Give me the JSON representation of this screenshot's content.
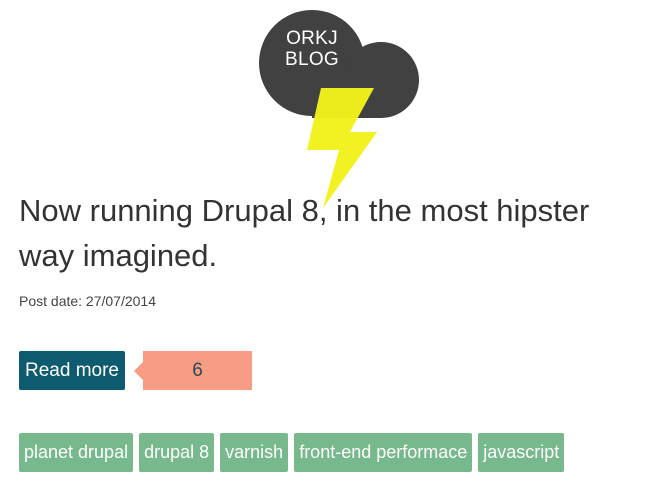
{
  "site": {
    "logo_line1": "ORKJ",
    "logo_line2": "BLOG",
    "cloud_color": "#414141",
    "bolt_color": "#f2f21c"
  },
  "article": {
    "title": "Now running Drupal 8, in the most hipster way imagined.",
    "post_date": "Post date: 27/07/2014",
    "read_more_label": "Read more",
    "comment_count": "6"
  },
  "tags": [
    {
      "label": "planet drupal"
    },
    {
      "label": "drupal 8"
    },
    {
      "label": "varnish"
    },
    {
      "label": "front-end performace"
    },
    {
      "label": "javascript"
    }
  ],
  "colors": {
    "read_more_bg": "#0e5a6e",
    "comment_bg": "#f89d84",
    "tag_bg": "#77b88c",
    "title_text": "#333333"
  }
}
